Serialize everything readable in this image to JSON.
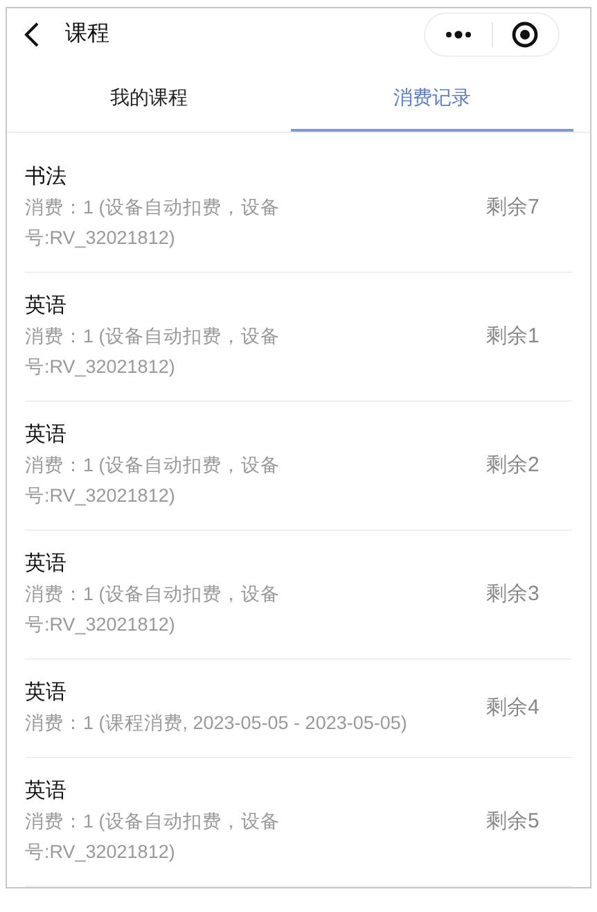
{
  "header": {
    "title": "课程"
  },
  "tabs": [
    {
      "label": "我的课程",
      "selected": false
    },
    {
      "label": "消费记录",
      "selected": true
    }
  ],
  "records": [
    {
      "course": "书法",
      "detail_lines": [
        "消费：1 (设备自动扣费，设备",
        "号:RV_32021812)"
      ],
      "remaining": "剩余7"
    },
    {
      "course": "英语",
      "detail_lines": [
        "消费：1 (设备自动扣费，设备",
        "号:RV_32021812)"
      ],
      "remaining": "剩余1"
    },
    {
      "course": "英语",
      "detail_lines": [
        "消费：1 (设备自动扣费，设备",
        "号:RV_32021812)"
      ],
      "remaining": "剩余2"
    },
    {
      "course": "英语",
      "detail_lines": [
        "消费：1 (设备自动扣费，设备",
        "号:RV_32021812)"
      ],
      "remaining": "剩余3"
    },
    {
      "course": "英语",
      "detail_lines": [
        "消费：1 (课程消费, 2023-05-05 - 2023-05-05)"
      ],
      "remaining": "剩余4"
    },
    {
      "course": "英语",
      "detail_lines": [
        "消费：1 (设备自动扣费，设备",
        "号:RV_32021812)"
      ],
      "remaining": "剩余5"
    }
  ]
}
